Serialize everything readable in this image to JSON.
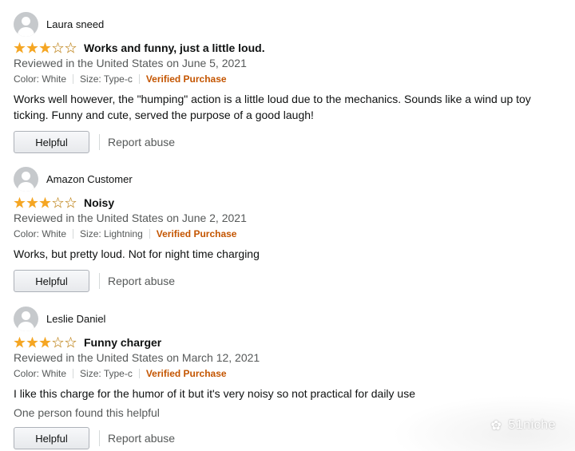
{
  "reviews": [
    {
      "author": "Laura sneed",
      "rating": 3,
      "title": "Works and funny, just a little loud.",
      "date": "Reviewed in the United States on June 5, 2021",
      "color": "Color: White",
      "size": "Size: Type-c",
      "verified": "Verified Purchase",
      "body": "Works well however, the \"humping\" action is a little loud due to the mechanics. Sounds like a wind up toy ticking. Funny and cute, served the purpose of a good laugh!",
      "helpful_label": "Helpful",
      "report_label": "Report abuse"
    },
    {
      "author": "Amazon Customer",
      "rating": 3,
      "title": "Noisy",
      "date": "Reviewed in the United States on June 2, 2021",
      "color": "Color: White",
      "size": "Size: Lightning",
      "verified": "Verified Purchase",
      "body": "Works, but pretty loud. Not for night time charging",
      "helpful_label": "Helpful",
      "report_label": "Report abuse"
    },
    {
      "author": "Leslie Daniel",
      "rating": 3,
      "title": "Funny charger",
      "date": "Reviewed in the United States on March 12, 2021",
      "color": "Color: White",
      "size": "Size: Type-c",
      "verified": "Verified Purchase",
      "body": "I like this charge for the humor of it but it's very noisy so not practical for daily use",
      "helpful_count": "One person found this helpful",
      "helpful_label": "Helpful",
      "report_label": "Report abuse"
    }
  ],
  "max_rating": 5,
  "colors": {
    "star": "#f5a623",
    "verified": "#c45500",
    "muted": "#565959"
  },
  "watermark": {
    "icon": "wechat-icon",
    "text": "51niche"
  }
}
